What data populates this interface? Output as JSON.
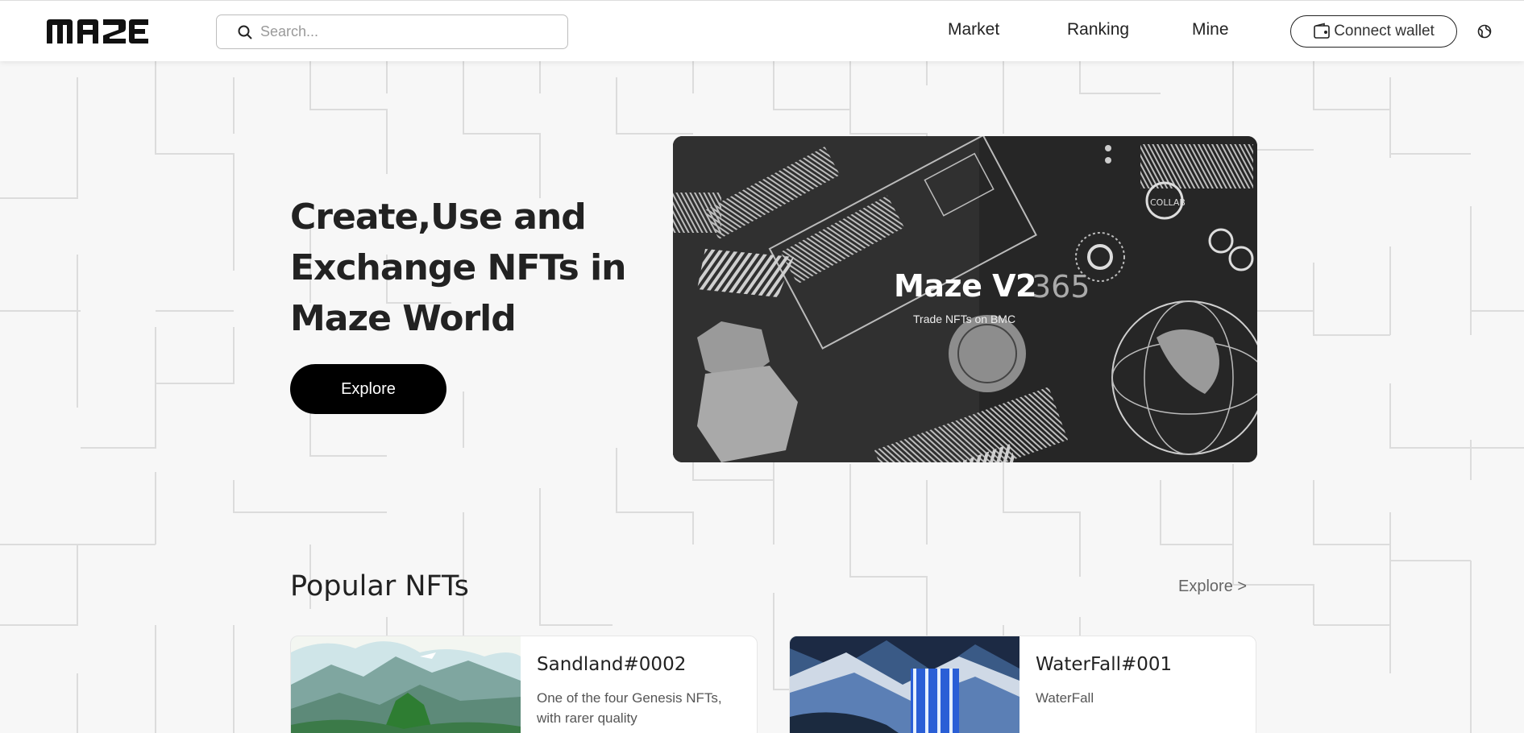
{
  "header": {
    "logo_text": "MAZE",
    "search_placeholder": "Search...",
    "nav": [
      "Market",
      "Ranking",
      "Mine"
    ],
    "connect_label": "Connect wallet"
  },
  "hero": {
    "title": "Create,Use and Exchange NFTs in Maze World",
    "explore_label": "Explore",
    "banner_title": "Maze V2",
    "banner_subtitle": "Trade NFTs on BMC"
  },
  "popular": {
    "title": "Popular NFTs",
    "explore_link": "Explore >",
    "cards": [
      {
        "name": "Sandland#0002",
        "description": "One of the four Genesis NFTs, with rarer quality"
      },
      {
        "name": "WaterFall#001",
        "description": "WaterFall"
      }
    ]
  },
  "colors": {
    "accent": "#000000",
    "background": "#f7f7f7",
    "text": "#222222"
  },
  "icons": {
    "search": "search-icon",
    "wallet": "wallet-icon",
    "language": "globe-icon"
  }
}
